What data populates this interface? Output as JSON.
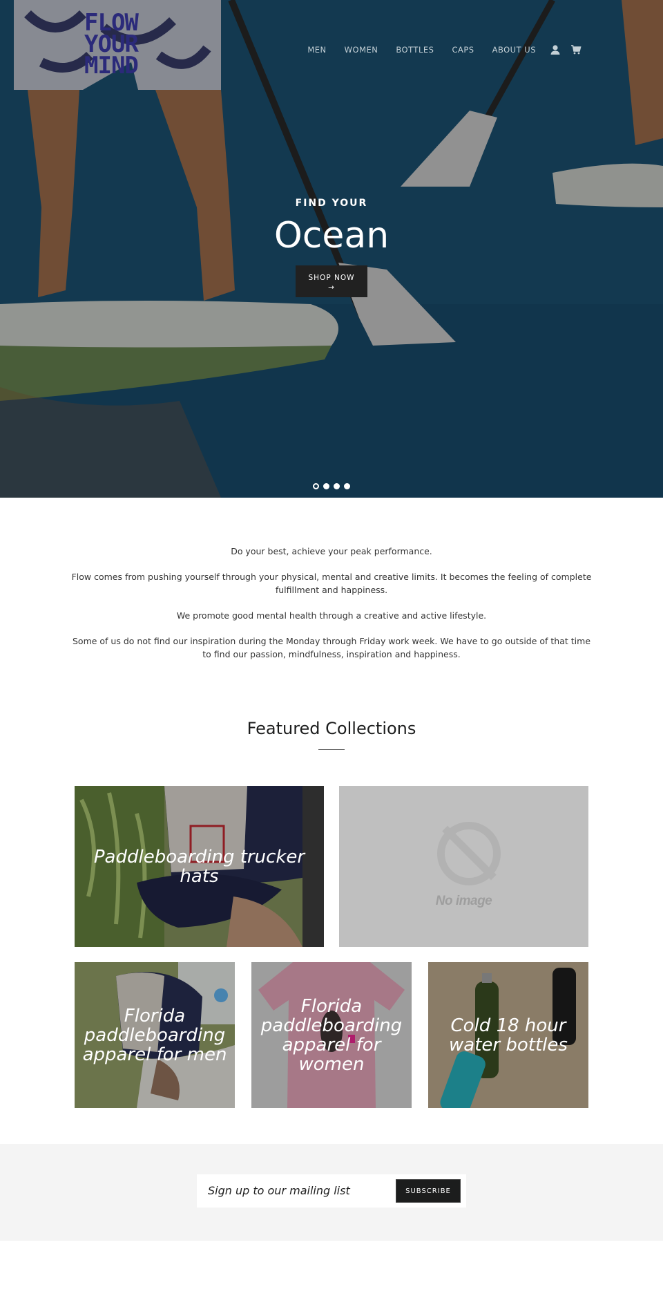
{
  "brand": {
    "logo_lines": [
      "FLOW",
      "YOUR",
      "MIND"
    ]
  },
  "nav": {
    "items": [
      {
        "label": "MEN"
      },
      {
        "label": "WOMEN"
      },
      {
        "label": "BOTTLES"
      },
      {
        "label": "CAPS"
      },
      {
        "label": "ABOUT US"
      }
    ],
    "account_icon": "user-icon",
    "cart_icon": "cart-icon"
  },
  "hero": {
    "subtitle": "FIND YOUR",
    "title": "Ocean",
    "button_label": "SHOP NOW",
    "button_arrow": "→",
    "slides_count": 4,
    "active_slide": 1
  },
  "intro": {
    "paragraphs": [
      "Do your best, achieve your peak performance.",
      "Flow comes from pushing yourself through your physical, mental and creative limits. It becomes the feeling of complete fulfillment and happiness.",
      "We promote good mental health through a creative and active lifestyle.",
      "Some of us do not find our inspiration during the Monday through Friday work week.  We have to go outside of that time to find our passion, mindfulness, inspiration and happiness."
    ]
  },
  "featured": {
    "title": "Featured Collections",
    "collections": [
      {
        "label": "Paddleboarding trucker hats"
      },
      {
        "label": "",
        "placeholder_text": "No image"
      },
      {
        "label": "Florida paddleboarding apparel for men"
      },
      {
        "label": "Florida paddleboarding apparel for women"
      },
      {
        "label": "Cold 18 hour water bottles"
      }
    ]
  },
  "newsletter": {
    "placeholder": "Sign up to our mailing list",
    "button_label": "SUBSCRIBE"
  }
}
